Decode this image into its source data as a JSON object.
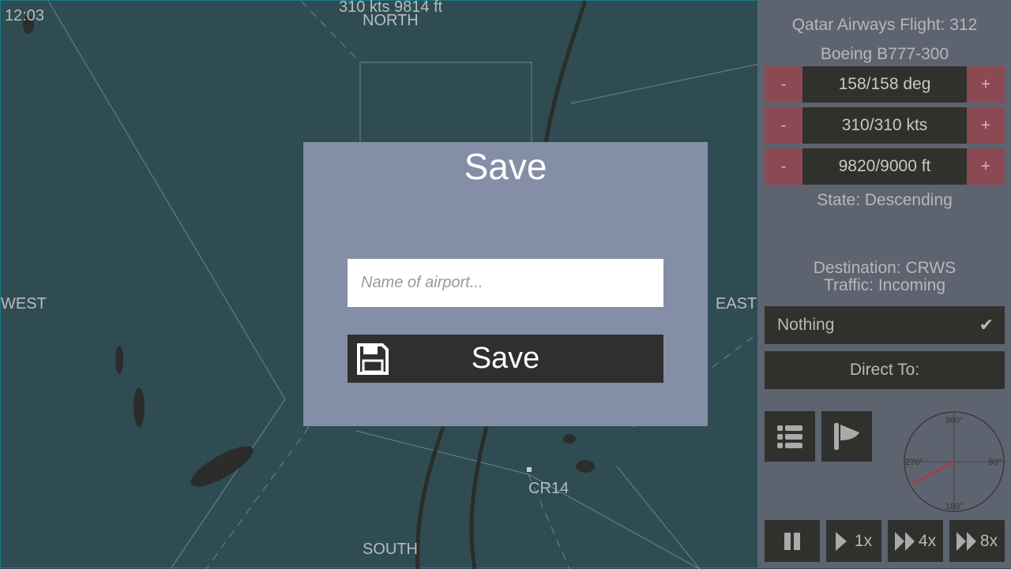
{
  "map": {
    "clock": "12:03",
    "speed_alt": "310 kts  9814 ft",
    "north": "NORTH",
    "south": "SOUTH",
    "east": "EAST",
    "west": "WEST",
    "waypoint": "CR14"
  },
  "panel": {
    "flight": "Qatar Airways Flight: 312",
    "aircraft": "Boeing B777-300",
    "heading": {
      "minus": "-",
      "value": "158/158 deg",
      "plus": "+"
    },
    "speed": {
      "minus": "-",
      "value": "310/310 kts",
      "plus": "+"
    },
    "altitude": {
      "minus": "-",
      "value": "9820/9000 ft",
      "plus": "+"
    },
    "state": "State: Descending",
    "destination": "Destination: CRWS",
    "traffic": "Traffic: Incoming",
    "nothing": "Nothing",
    "direct_to": "Direct To:",
    "compass": {
      "n": "360°",
      "e": "90°",
      "s": "180°",
      "w": "270°",
      "heading_deg": 242
    },
    "speeds": [
      "1x",
      "4x",
      "8x"
    ]
  },
  "dialog": {
    "title": "Save",
    "placeholder": "Name of airport...",
    "save_label": "Save"
  },
  "colors": {
    "accent_red": "#8b4a53",
    "panel": "#5e6370",
    "dialog": "#848ea6",
    "map": "#2f4c53"
  }
}
